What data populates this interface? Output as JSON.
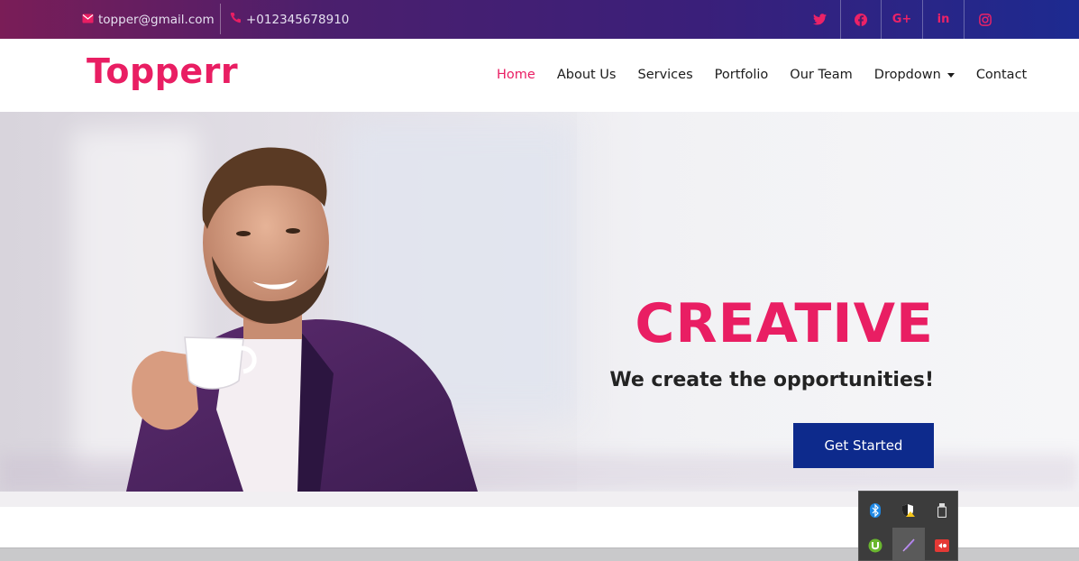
{
  "topbar": {
    "email": "topper@gmail.com",
    "phone": "+012345678910",
    "socials": [
      "twitter-icon",
      "facebook-icon",
      "google-plus-icon",
      "linkedin-icon",
      "instagram-icon"
    ],
    "social_glyphs": [
      "",
      "",
      "G+",
      "in",
      ""
    ],
    "accent": "#ec2267"
  },
  "navbar": {
    "brand": "Topperr",
    "items": [
      {
        "label": "Home",
        "active": true
      },
      {
        "label": "About Us"
      },
      {
        "label": "Services"
      },
      {
        "label": "Portfolio"
      },
      {
        "label": "Our Team"
      },
      {
        "label": "Dropdown",
        "has_caret": true
      },
      {
        "label": "Contact"
      }
    ]
  },
  "hero": {
    "title": "CREATIVE",
    "subtitle": "We create the opportunities!",
    "cta": "Get Started",
    "colors": {
      "title": "#e91e63",
      "cta_bg": "#0d2a8c"
    }
  },
  "tray": {
    "icons": [
      "bluetooth-icon",
      "security-warning-icon",
      "usb-drive-icon",
      "utorrent-icon",
      "feather-pen-icon",
      "media-recorder-icon"
    ]
  }
}
